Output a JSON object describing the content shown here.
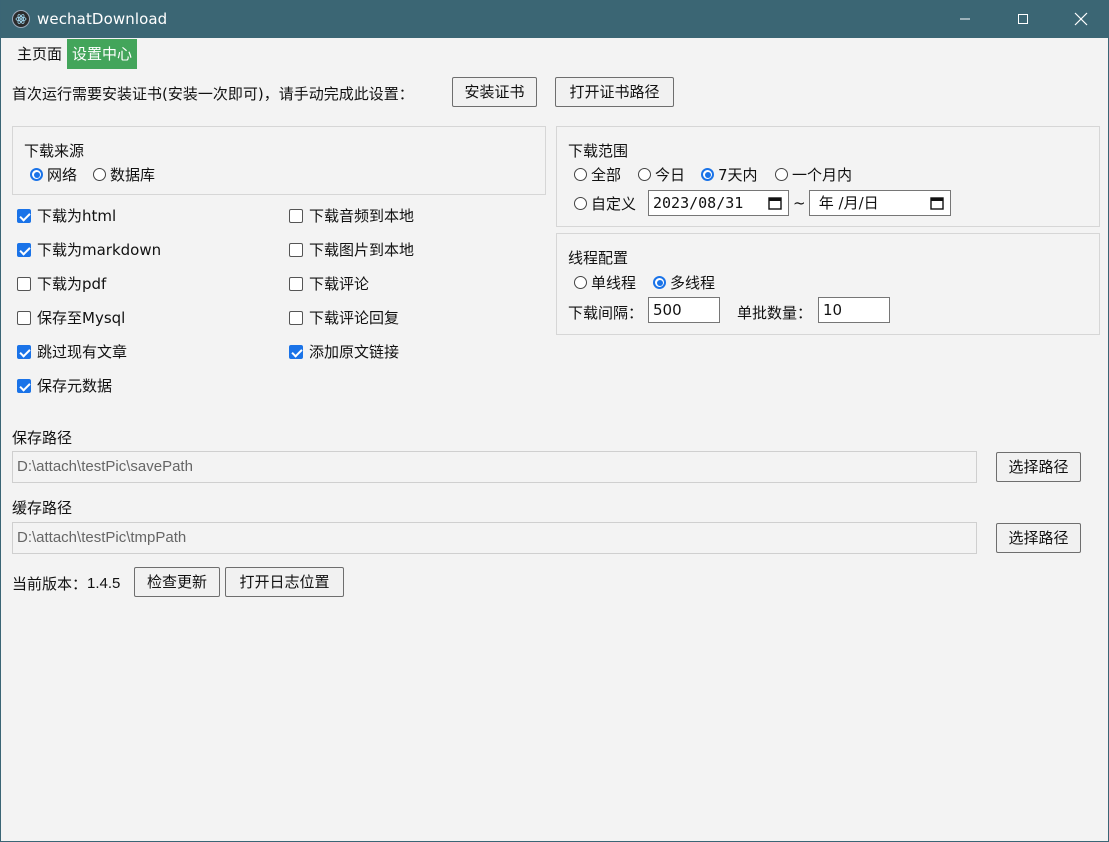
{
  "window": {
    "title": "wechatDownload"
  },
  "menu": {
    "items": [
      {
        "label": "主页面",
        "active": false
      },
      {
        "label": "设置中心",
        "active": true
      }
    ]
  },
  "cert": {
    "notice": "首次运行需要安装证书(安装一次即可)，请手动完成此设置：",
    "install_label": "安装证书",
    "open_path_label": "打开证书路径"
  },
  "source": {
    "title": "下载来源",
    "options": [
      {
        "label": "网络",
        "checked": true
      },
      {
        "label": "数据库",
        "checked": false
      }
    ]
  },
  "options_left": [
    {
      "label": "下载为html",
      "checked": true
    },
    {
      "label": "下载为markdown",
      "checked": true
    },
    {
      "label": "下载为pdf",
      "checked": false
    },
    {
      "label": "保存至Mysql",
      "checked": false
    },
    {
      "label": "跳过现有文章",
      "checked": true
    },
    {
      "label": "保存元数据",
      "checked": true
    }
  ],
  "options_right": [
    {
      "label": "下载音频到本地",
      "checked": false
    },
    {
      "label": "下载图片到本地",
      "checked": false
    },
    {
      "label": "下载评论",
      "checked": false
    },
    {
      "label": "下载评论回复",
      "checked": false
    },
    {
      "label": "添加原文链接",
      "checked": true
    }
  ],
  "range": {
    "title": "下载范围",
    "options": [
      {
        "label": "全部",
        "checked": false
      },
      {
        "label": "今日",
        "checked": false
      },
      {
        "label": "7天内",
        "checked": true
      },
      {
        "label": "一个月内",
        "checked": false
      }
    ],
    "custom_label": "自定义",
    "custom_checked": false,
    "start_date": "2023/08/31",
    "separator": "~",
    "end_date": " 年 /月/日"
  },
  "thread": {
    "title": "线程配置",
    "options": [
      {
        "label": "单线程",
        "checked": false
      },
      {
        "label": "多线程",
        "checked": true
      }
    ],
    "interval_label": "下载间隔：",
    "interval_value": "500",
    "batch_label": "单批数量：",
    "batch_value": "10"
  },
  "save_path": {
    "label": "保存路径",
    "value": "D:\\attach\\testPic\\savePath",
    "button_label": "选择路径"
  },
  "tmp_path": {
    "label": "缓存路径",
    "value": "D:\\attach\\testPic\\tmpPath",
    "button_label": "选择路径"
  },
  "version": {
    "label": "当前版本：",
    "value": "1.4.5",
    "check_update_label": "检查更新",
    "open_log_label": "打开日志位置"
  },
  "icons": {
    "app": "electron-logo-icon",
    "minimize": "minimize-icon",
    "maximize": "maximize-icon",
    "close": "close-icon",
    "calendar": "calendar-icon"
  },
  "colors": {
    "titlebar": "#3b6674",
    "active_menu": "#43a55b",
    "accent": "#1a73e8"
  }
}
